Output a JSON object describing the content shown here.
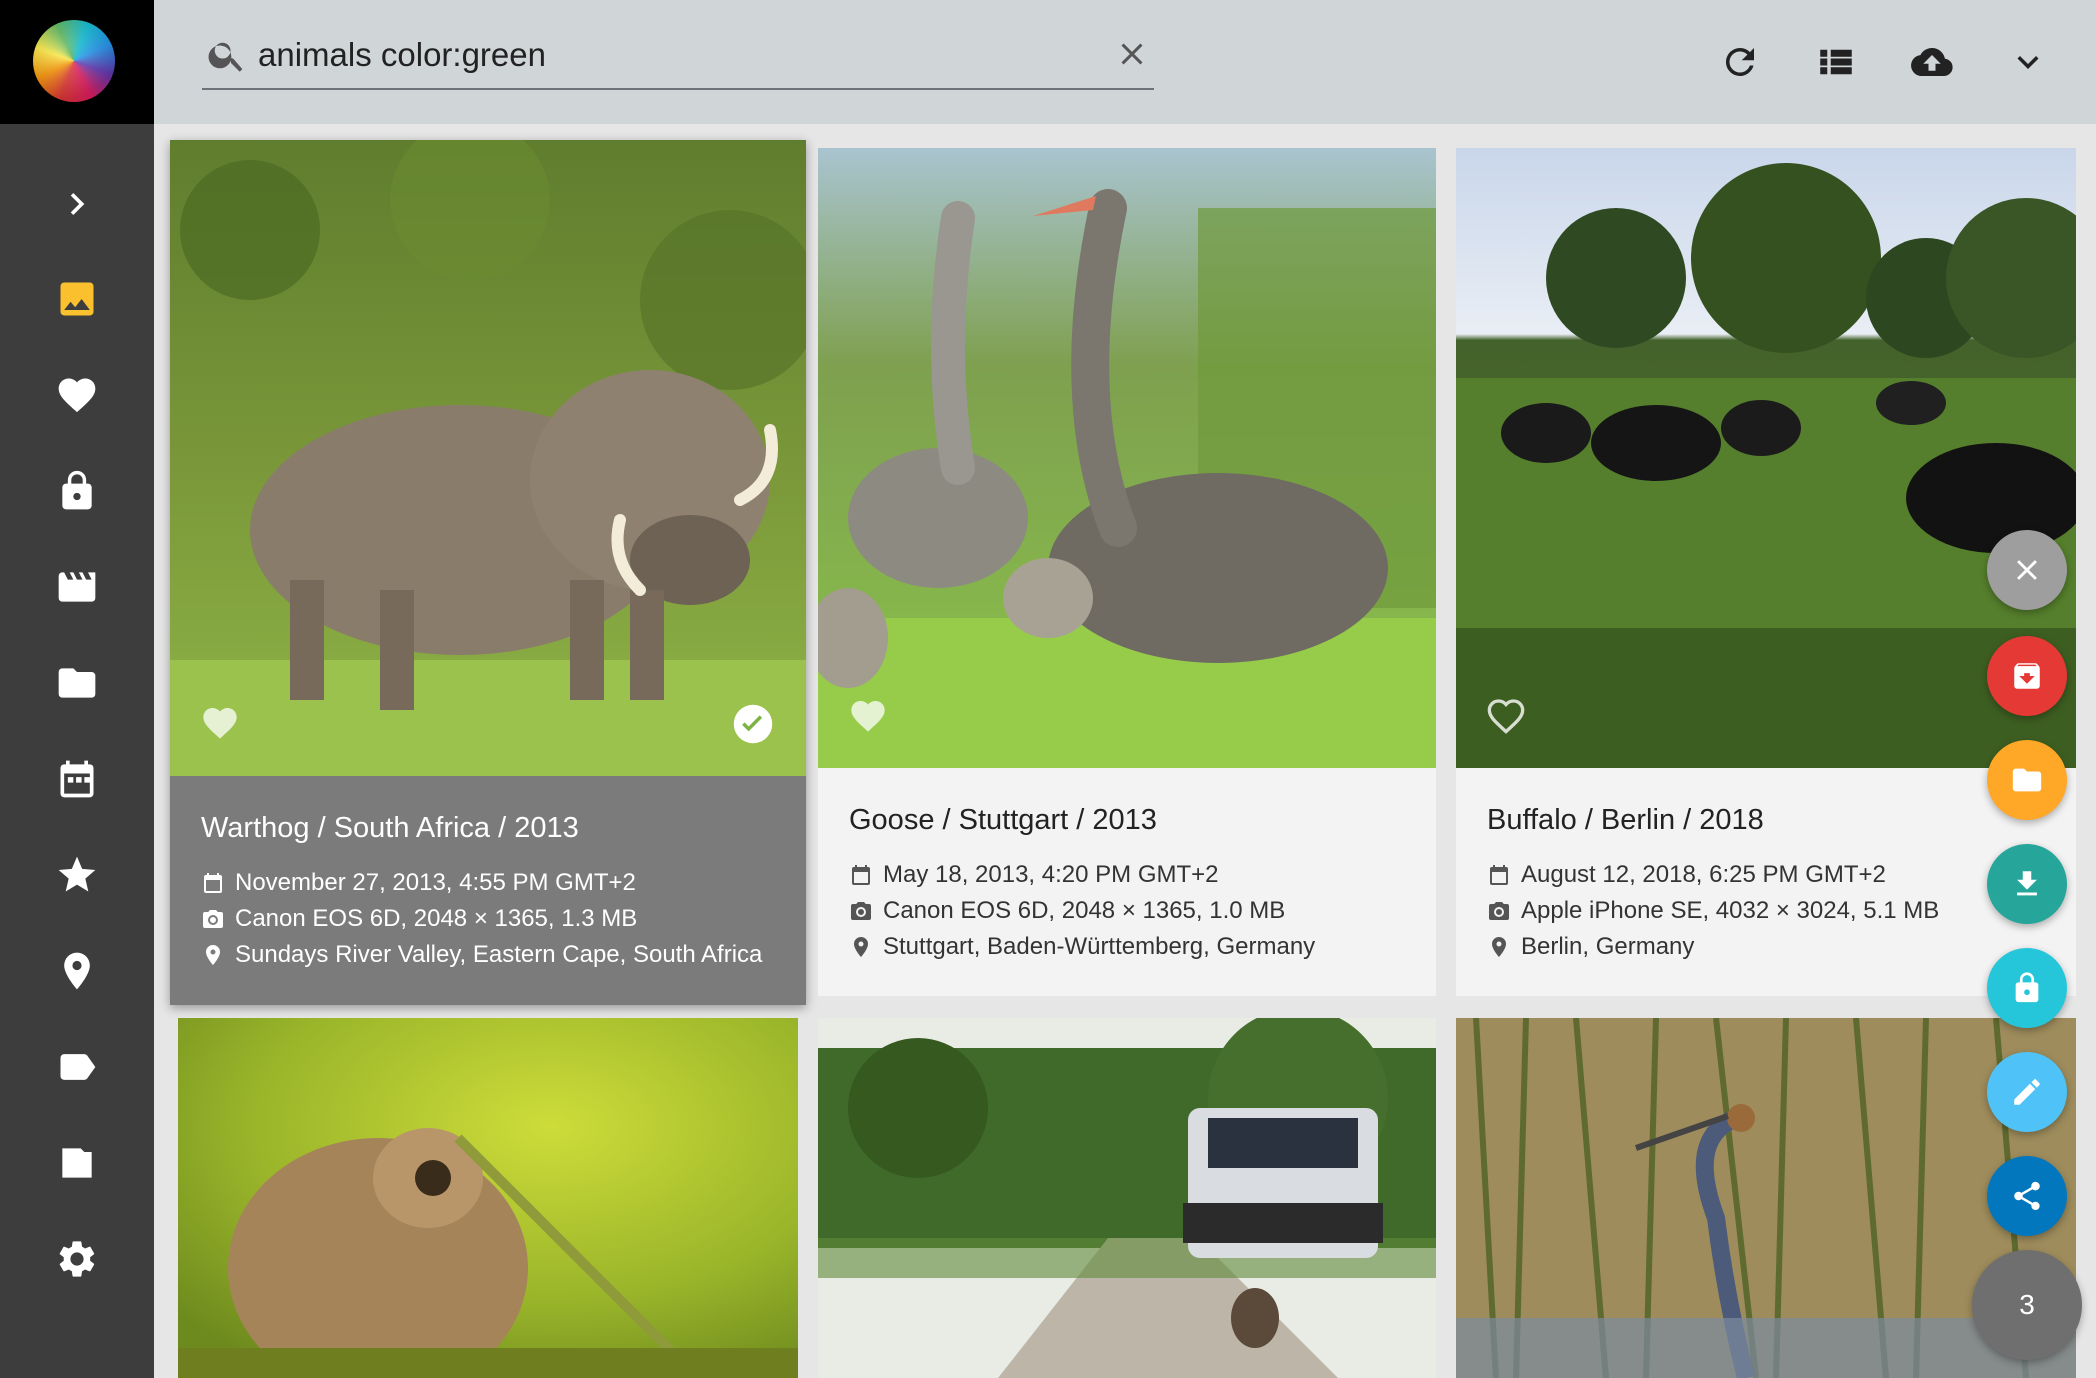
{
  "search": {
    "value": "animals color:green",
    "placeholder": "Search"
  },
  "toolbar": {
    "icons": [
      "refresh-icon",
      "list-view-icon",
      "upload-icon",
      "expand-icon"
    ]
  },
  "sidebar": {
    "items": [
      {
        "name": "expand",
        "icon": "chevron-right-icon"
      },
      {
        "name": "photos",
        "icon": "image-icon",
        "active": true
      },
      {
        "name": "favorites",
        "icon": "heart-icon"
      },
      {
        "name": "private",
        "icon": "lock-icon"
      },
      {
        "name": "videos",
        "icon": "movie-icon"
      },
      {
        "name": "folders",
        "icon": "folder-icon"
      },
      {
        "name": "calendar",
        "icon": "calendar-icon"
      },
      {
        "name": "moments",
        "icon": "star-icon"
      },
      {
        "name": "places",
        "icon": "place-icon"
      },
      {
        "name": "labels",
        "icon": "label-icon"
      },
      {
        "name": "library",
        "icon": "library-icon"
      },
      {
        "name": "settings",
        "icon": "gear-icon"
      }
    ]
  },
  "cards": [
    {
      "title": "Warthog / South Africa / 2013",
      "date": "November 27, 2013, 4:55 PM GMT+2",
      "camera": "Canon EOS 6D, 2048 × 1365, 1.3 MB",
      "location": "Sundays River Valley, Eastern Cape, South Africa",
      "selected": true
    },
    {
      "title": "Goose / Stuttgart / 2013",
      "date": "May 18, 2013, 4:20 PM GMT+2",
      "camera": "Canon EOS 6D, 2048 × 1365, 1.0 MB",
      "location": "Stuttgart, Baden-Württemberg, Germany",
      "selected": false
    },
    {
      "title": "Buffalo / Berlin / 2018",
      "date": "August 12, 2018, 6:25 PM GMT+2",
      "camera": "Apple iPhone SE, 4032 × 3024, 5.1 MB",
      "location": "Berlin, Germany",
      "selected": false
    }
  ],
  "fabs": [
    {
      "name": "close",
      "color": "#9e9e9e"
    },
    {
      "name": "archive",
      "color": "#e53935"
    },
    {
      "name": "album",
      "color": "#ffa726"
    },
    {
      "name": "download",
      "color": "#26a69a"
    },
    {
      "name": "private",
      "color": "#26c6da"
    },
    {
      "name": "edit",
      "color": "#4fc3f7"
    },
    {
      "name": "share",
      "color": "#0277bd"
    }
  ],
  "selection": {
    "count": "3"
  },
  "colors": {
    "accent": "#fbc02d",
    "sidebar": "#3d3d3d",
    "topbar": "#d0d5d8"
  }
}
